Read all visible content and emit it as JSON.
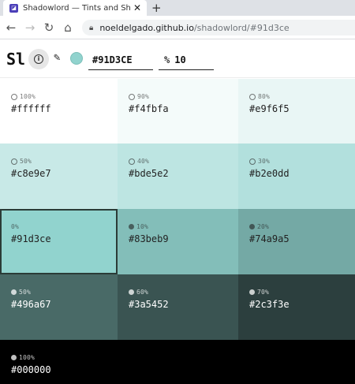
{
  "browser": {
    "tab_title": "Shadowlord — Tints and Shades",
    "favicon_glyph": "◪",
    "close_glyph": "✕",
    "new_tab_glyph": "+",
    "url_host": "noeldelgado.github.io",
    "url_path": "/shadowlord/#91d3ce",
    "back_glyph": "←",
    "forward_glyph": "→",
    "reload_glyph": "↻",
    "home_glyph": "⌂",
    "lock_glyph": "🔒"
  },
  "header": {
    "logo": "Sl",
    "info_glyph": "i",
    "picker_glyph": "✎",
    "swatch_color": "#91d3ce",
    "hex_value": "#91D3CE",
    "percent_symbol": "%",
    "percent_value": "10"
  },
  "tints": [
    {
      "pct": "100%",
      "hex": "#ffffff",
      "bg": "#ffffff",
      "fg": "#222222",
      "marker": "ring"
    },
    {
      "pct": "90%",
      "hex": "#f4fbfa",
      "bg": "#f4fbfa",
      "fg": "#222222",
      "marker": "ring"
    },
    {
      "pct": "80%",
      "hex": "#e9f6f5",
      "bg": "#e9f6f5",
      "fg": "#222222",
      "marker": "ring"
    },
    {
      "pct": "50%",
      "hex": "#c8e9e7",
      "bg": "#c8e9e7",
      "fg": "#222222",
      "marker": "ring"
    },
    {
      "pct": "40%",
      "hex": "#bde5e2",
      "bg": "#bde5e2",
      "fg": "#222222",
      "marker": "ring"
    },
    {
      "pct": "30%",
      "hex": "#b2e0dd",
      "bg": "#b2e0dd",
      "fg": "#222222",
      "marker": "ring"
    },
    {
      "pct": "0%",
      "hex": "#91d3ce",
      "bg": "#91d3ce",
      "fg": "#222222",
      "marker": "none",
      "selected": true
    },
    {
      "pct": "10%",
      "hex": "#83beb9",
      "bg": "#83beb9",
      "fg": "#222222",
      "marker": "disc"
    },
    {
      "pct": "20%",
      "hex": "#74a9a5",
      "bg": "#74a9a5",
      "fg": "#222222",
      "marker": "disc"
    },
    {
      "pct": "50%",
      "hex": "#496a67",
      "bg": "#496a67",
      "fg": "#ffffff",
      "marker": "disc"
    },
    {
      "pct": "60%",
      "hex": "#3a5452",
      "bg": "#3a5452",
      "fg": "#ffffff",
      "marker": "disc"
    },
    {
      "pct": "70%",
      "hex": "#2c3f3e",
      "bg": "#2c3f3e",
      "fg": "#ffffff",
      "marker": "disc"
    },
    {
      "pct": "100%",
      "hex": "#000000",
      "bg": "#000000",
      "fg": "#ffffff",
      "marker": "disc",
      "full": true
    }
  ]
}
